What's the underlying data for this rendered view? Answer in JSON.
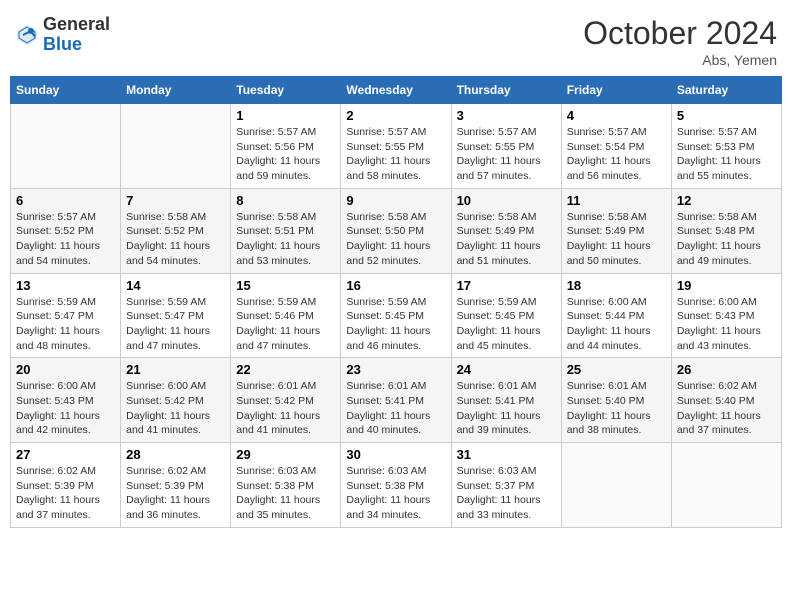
{
  "header": {
    "logo_general": "General",
    "logo_blue": "Blue",
    "month": "October 2024",
    "location": "Abs, Yemen"
  },
  "days_of_week": [
    "Sunday",
    "Monday",
    "Tuesday",
    "Wednesday",
    "Thursday",
    "Friday",
    "Saturday"
  ],
  "weeks": [
    [
      {
        "day": "",
        "info": ""
      },
      {
        "day": "",
        "info": ""
      },
      {
        "day": "1",
        "info": "Sunrise: 5:57 AM\nSunset: 5:56 PM\nDaylight: 11 hours and 59 minutes."
      },
      {
        "day": "2",
        "info": "Sunrise: 5:57 AM\nSunset: 5:55 PM\nDaylight: 11 hours and 58 minutes."
      },
      {
        "day": "3",
        "info": "Sunrise: 5:57 AM\nSunset: 5:55 PM\nDaylight: 11 hours and 57 minutes."
      },
      {
        "day": "4",
        "info": "Sunrise: 5:57 AM\nSunset: 5:54 PM\nDaylight: 11 hours and 56 minutes."
      },
      {
        "day": "5",
        "info": "Sunrise: 5:57 AM\nSunset: 5:53 PM\nDaylight: 11 hours and 55 minutes."
      }
    ],
    [
      {
        "day": "6",
        "info": "Sunrise: 5:57 AM\nSunset: 5:52 PM\nDaylight: 11 hours and 54 minutes."
      },
      {
        "day": "7",
        "info": "Sunrise: 5:58 AM\nSunset: 5:52 PM\nDaylight: 11 hours and 54 minutes."
      },
      {
        "day": "8",
        "info": "Sunrise: 5:58 AM\nSunset: 5:51 PM\nDaylight: 11 hours and 53 minutes."
      },
      {
        "day": "9",
        "info": "Sunrise: 5:58 AM\nSunset: 5:50 PM\nDaylight: 11 hours and 52 minutes."
      },
      {
        "day": "10",
        "info": "Sunrise: 5:58 AM\nSunset: 5:49 PM\nDaylight: 11 hours and 51 minutes."
      },
      {
        "day": "11",
        "info": "Sunrise: 5:58 AM\nSunset: 5:49 PM\nDaylight: 11 hours and 50 minutes."
      },
      {
        "day": "12",
        "info": "Sunrise: 5:58 AM\nSunset: 5:48 PM\nDaylight: 11 hours and 49 minutes."
      }
    ],
    [
      {
        "day": "13",
        "info": "Sunrise: 5:59 AM\nSunset: 5:47 PM\nDaylight: 11 hours and 48 minutes."
      },
      {
        "day": "14",
        "info": "Sunrise: 5:59 AM\nSunset: 5:47 PM\nDaylight: 11 hours and 47 minutes."
      },
      {
        "day": "15",
        "info": "Sunrise: 5:59 AM\nSunset: 5:46 PM\nDaylight: 11 hours and 47 minutes."
      },
      {
        "day": "16",
        "info": "Sunrise: 5:59 AM\nSunset: 5:45 PM\nDaylight: 11 hours and 46 minutes."
      },
      {
        "day": "17",
        "info": "Sunrise: 5:59 AM\nSunset: 5:45 PM\nDaylight: 11 hours and 45 minutes."
      },
      {
        "day": "18",
        "info": "Sunrise: 6:00 AM\nSunset: 5:44 PM\nDaylight: 11 hours and 44 minutes."
      },
      {
        "day": "19",
        "info": "Sunrise: 6:00 AM\nSunset: 5:43 PM\nDaylight: 11 hours and 43 minutes."
      }
    ],
    [
      {
        "day": "20",
        "info": "Sunrise: 6:00 AM\nSunset: 5:43 PM\nDaylight: 11 hours and 42 minutes."
      },
      {
        "day": "21",
        "info": "Sunrise: 6:00 AM\nSunset: 5:42 PM\nDaylight: 11 hours and 41 minutes."
      },
      {
        "day": "22",
        "info": "Sunrise: 6:01 AM\nSunset: 5:42 PM\nDaylight: 11 hours and 41 minutes."
      },
      {
        "day": "23",
        "info": "Sunrise: 6:01 AM\nSunset: 5:41 PM\nDaylight: 11 hours and 40 minutes."
      },
      {
        "day": "24",
        "info": "Sunrise: 6:01 AM\nSunset: 5:41 PM\nDaylight: 11 hours and 39 minutes."
      },
      {
        "day": "25",
        "info": "Sunrise: 6:01 AM\nSunset: 5:40 PM\nDaylight: 11 hours and 38 minutes."
      },
      {
        "day": "26",
        "info": "Sunrise: 6:02 AM\nSunset: 5:40 PM\nDaylight: 11 hours and 37 minutes."
      }
    ],
    [
      {
        "day": "27",
        "info": "Sunrise: 6:02 AM\nSunset: 5:39 PM\nDaylight: 11 hours and 37 minutes."
      },
      {
        "day": "28",
        "info": "Sunrise: 6:02 AM\nSunset: 5:39 PM\nDaylight: 11 hours and 36 minutes."
      },
      {
        "day": "29",
        "info": "Sunrise: 6:03 AM\nSunset: 5:38 PM\nDaylight: 11 hours and 35 minutes."
      },
      {
        "day": "30",
        "info": "Sunrise: 6:03 AM\nSunset: 5:38 PM\nDaylight: 11 hours and 34 minutes."
      },
      {
        "day": "31",
        "info": "Sunrise: 6:03 AM\nSunset: 5:37 PM\nDaylight: 11 hours and 33 minutes."
      },
      {
        "day": "",
        "info": ""
      },
      {
        "day": "",
        "info": ""
      }
    ]
  ]
}
